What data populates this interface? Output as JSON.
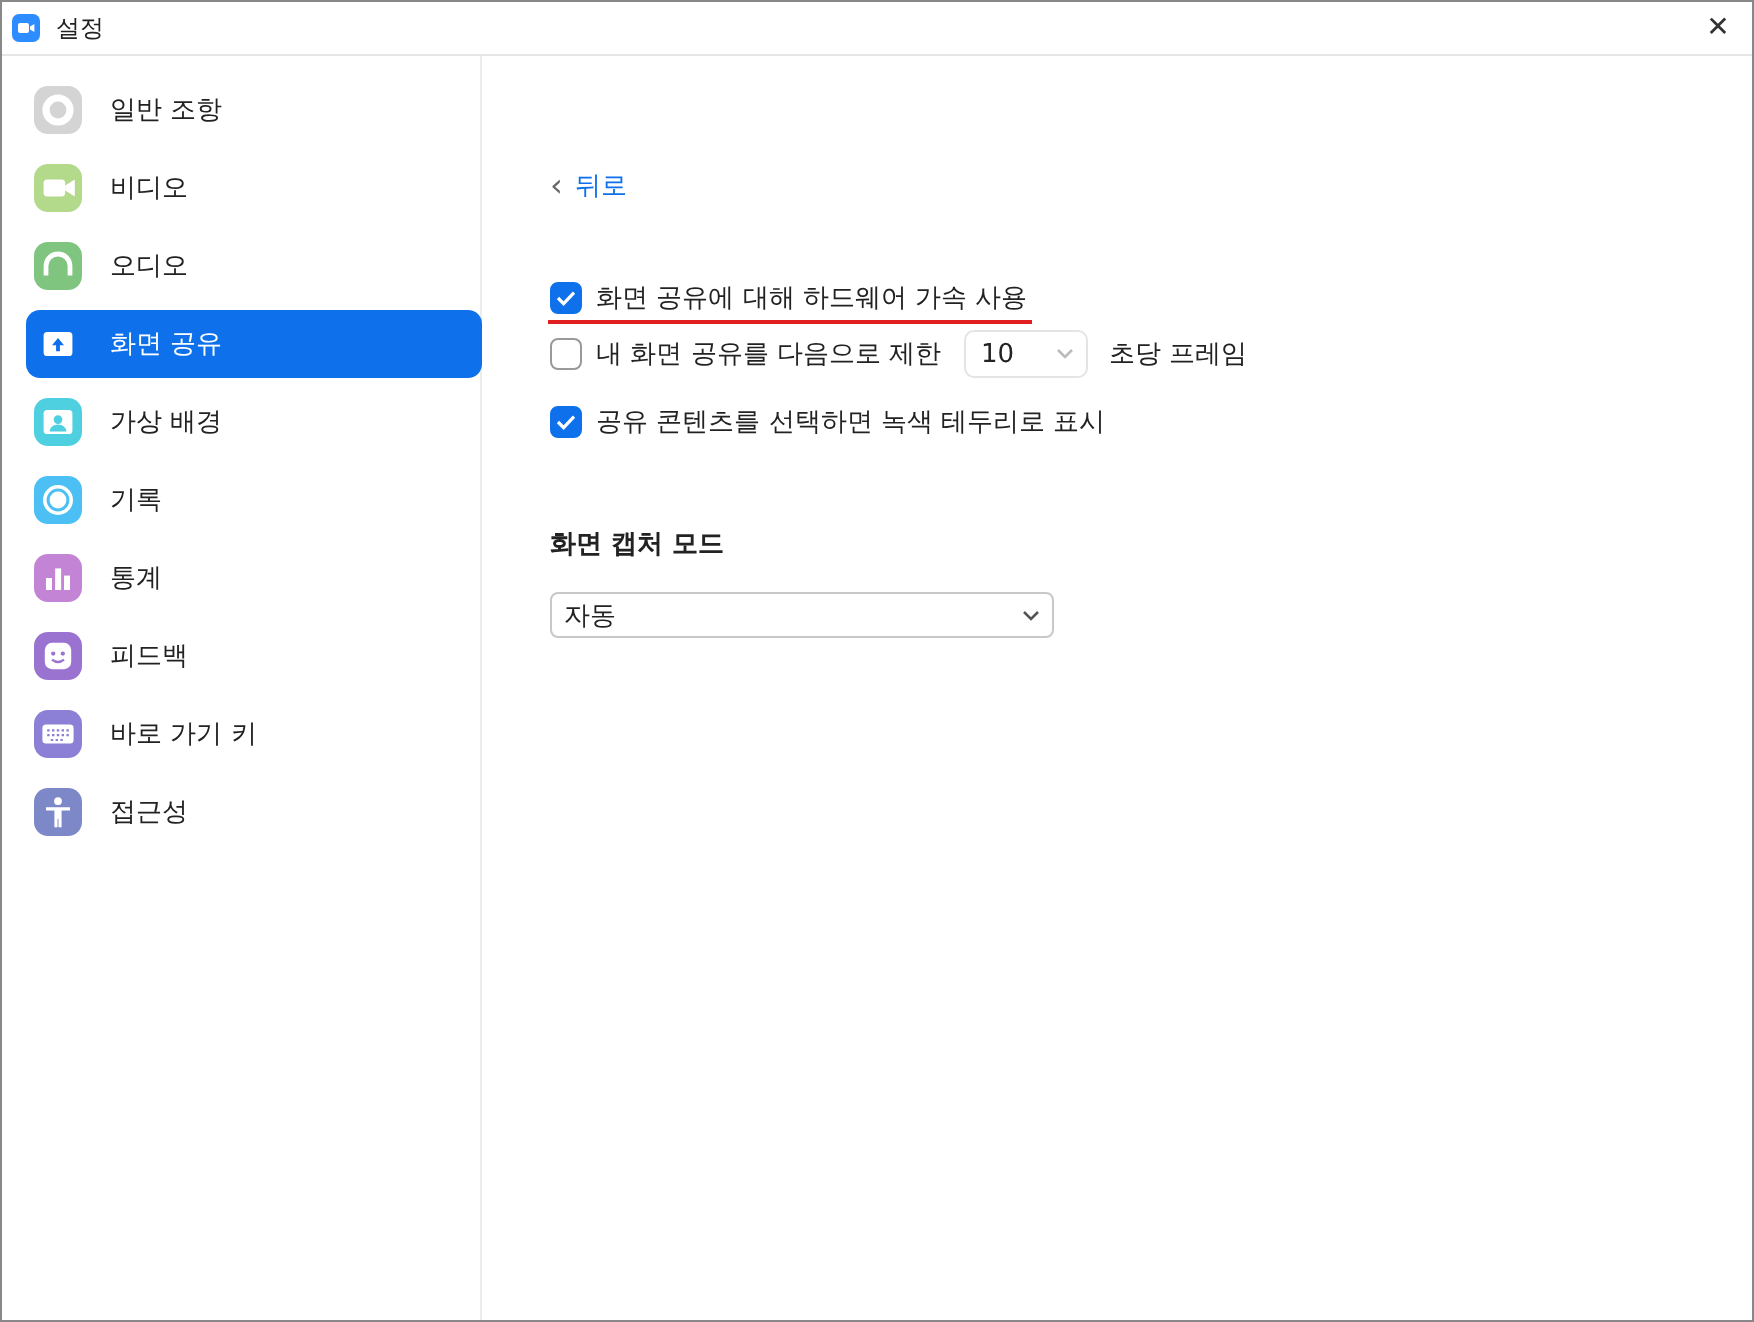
{
  "window": {
    "title": "설정",
    "close": "✕"
  },
  "sidebar": {
    "items": [
      {
        "label": "일반 조항",
        "kind": "gear",
        "color": "#d4d4d4",
        "selected": false
      },
      {
        "label": "비디오",
        "kind": "camera",
        "color": "#b3d98a",
        "selected": false
      },
      {
        "label": "오디오",
        "kind": "headphones",
        "color": "#7fc47f",
        "selected": false
      },
      {
        "label": "화면 공유",
        "kind": "share",
        "color": "#0e71eb",
        "selected": true
      },
      {
        "label": "가상 배경",
        "kind": "person",
        "color": "#4fd0e0",
        "selected": false
      },
      {
        "label": "기록",
        "kind": "record",
        "color": "#4cc0f5",
        "selected": false
      },
      {
        "label": "통계",
        "kind": "chart",
        "color": "#c484d6",
        "selected": false
      },
      {
        "label": "피드백",
        "kind": "smile",
        "color": "#9a73d1",
        "selected": false
      },
      {
        "label": "바로 가기 키",
        "kind": "keyboard",
        "color": "#8b7fd6",
        "selected": false
      },
      {
        "label": "접근성",
        "kind": "accessibility",
        "color": "#7d88c9",
        "selected": false
      }
    ]
  },
  "back": {
    "icon": "‹",
    "label": "뒤로"
  },
  "options": [
    {
      "kind": "check",
      "label": "화면 공유에 대해 하드웨어 가속 사용",
      "checked": true,
      "underlined": true
    },
    {
      "kind": "limit",
      "label": "내 화면 공유를 다음으로 제한",
      "value": "10",
      "suffix": "초당 프레임",
      "checked": false,
      "underlined": false
    },
    {
      "kind": "check",
      "label": "공유 콘텐츠를 선택하면 녹색 테두리로 표시",
      "checked": true,
      "underlined": false
    }
  ],
  "capture": {
    "heading": "화면 캡처 모드",
    "value": "자동"
  }
}
